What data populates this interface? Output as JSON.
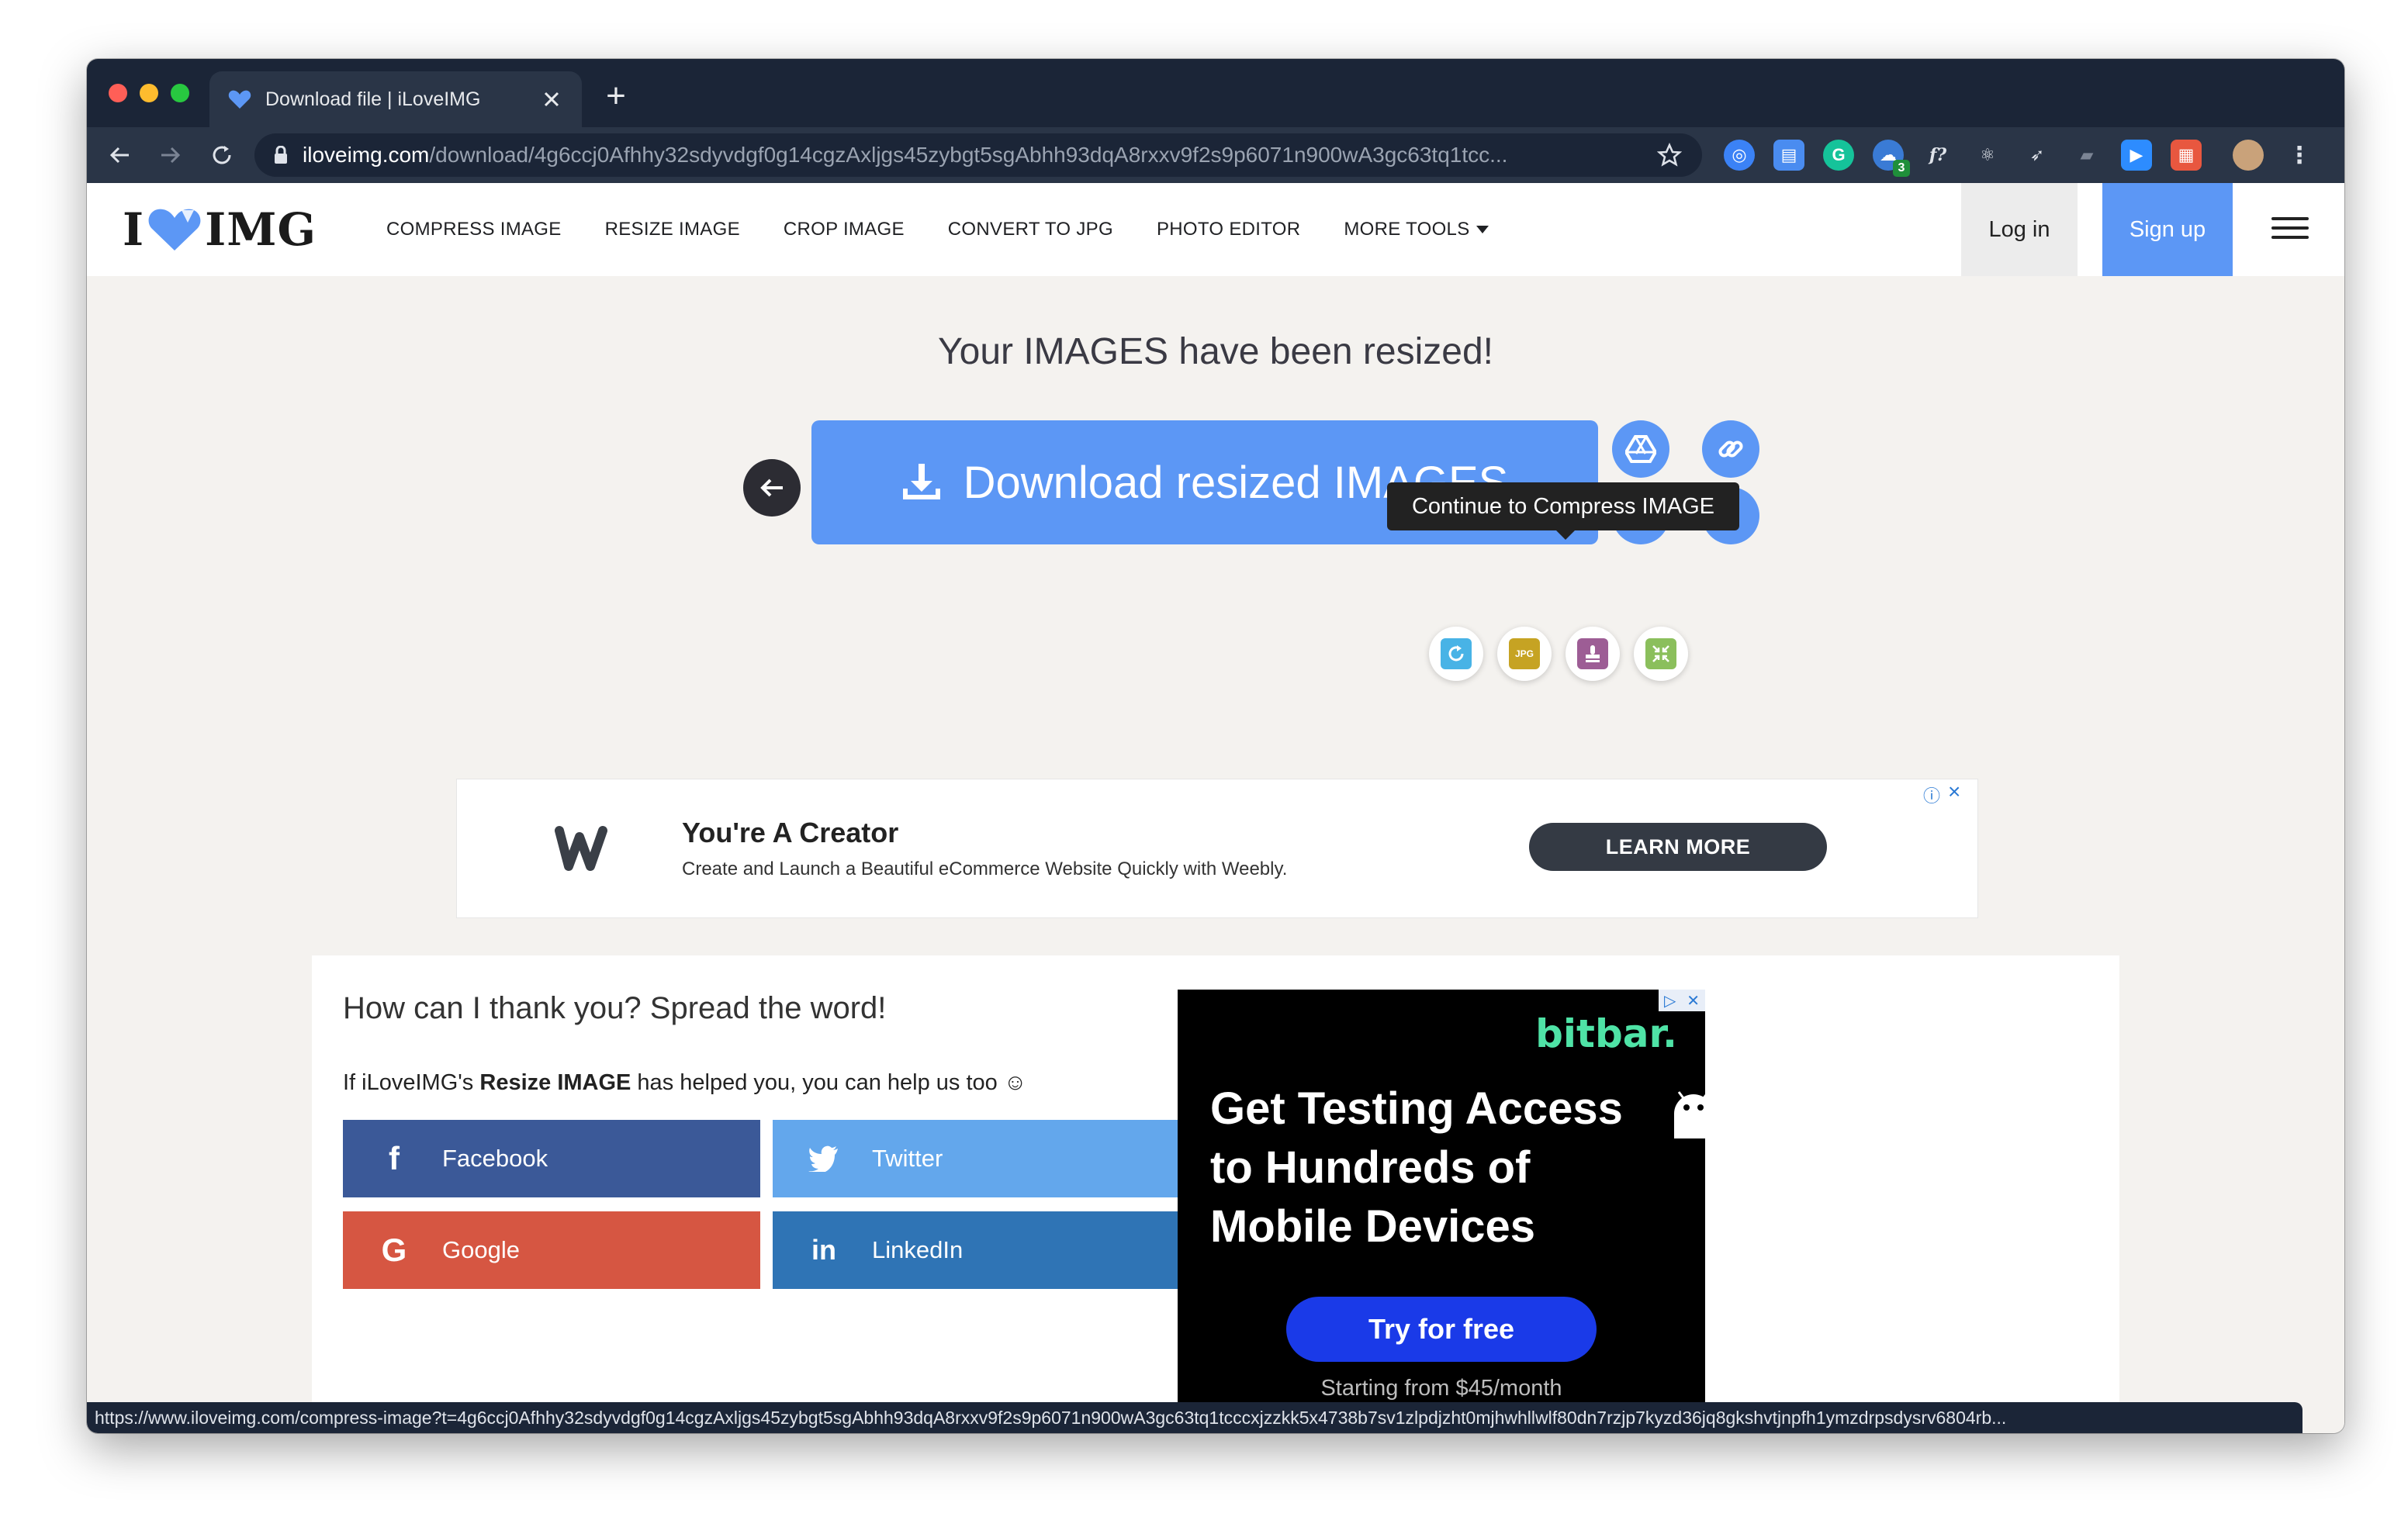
{
  "browser": {
    "tab_title": "Download file | iLoveIMG",
    "new_tab": "+",
    "url_host": "iloveimg.com",
    "url_path": "/download/4g6ccj0Afhhy32sdyvdgf0g14cgzAxljgs45zybgt5sgAbhh93dqA8rxxv9f2s9p6071n900wA3gc63tq1tcc...",
    "extension_badge": "3",
    "status_url": "https://www.iloveimg.com/compress-image?t=4g6ccj0Afhhy32sdyvdgf0g14cgzAxljgs45zybgt5sgAbhh93dqA8rxxv9f2s9p6071n900wA3gc63tq1tcccxjzzkk5x4738b7sv1zlpdjzht0mjhwhllwlf80dn7rzjp7kyzd36jq8gkshvtjnpfh1ymzdrpsdysrv6804rb..."
  },
  "header": {
    "logo_left": "I",
    "logo_right": "IMG",
    "nav": [
      "COMPRESS IMAGE",
      "RESIZE IMAGE",
      "CROP IMAGE",
      "CONVERT TO JPG",
      "PHOTO EDITOR",
      "MORE TOOLS"
    ],
    "login": "Log in",
    "signup": "Sign up"
  },
  "main": {
    "headline": "Your IMAGES have been resized!",
    "download_label": "Download resized IMAGES",
    "tooltip": "Continue to Compress IMAGE",
    "tool_jpg_label": "JPG"
  },
  "ad_banner": {
    "title": "You're A Creator",
    "description": "Create and Launch a Beautiful eCommerce Website Quickly with Weebly.",
    "cta": "LEARN MORE"
  },
  "share": {
    "title": "How can I thank you? Spread the word!",
    "text_prefix": "If iLoveIMG's ",
    "text_tool": "Resize IMAGE",
    "text_suffix": " has helped you, you can help us too ☺",
    "buttons": [
      {
        "label": "Facebook",
        "color": "#3b5998"
      },
      {
        "label": "Twitter",
        "color": "#63a7ec"
      },
      {
        "label": "Google",
        "color": "#d65642"
      },
      {
        "label": "LinkedIn",
        "color": "#2f74b5"
      }
    ]
  },
  "side_ad": {
    "brand": "bitbar.",
    "headline": "Get Testing Access to Hundreds of Mobile Devices",
    "cta": "Try for free",
    "price": "Starting from $45/month"
  },
  "colors": {
    "accent": "#5c97f5",
    "page_bg": "#f4f2ef",
    "chrome_dark": "#1b2537"
  }
}
